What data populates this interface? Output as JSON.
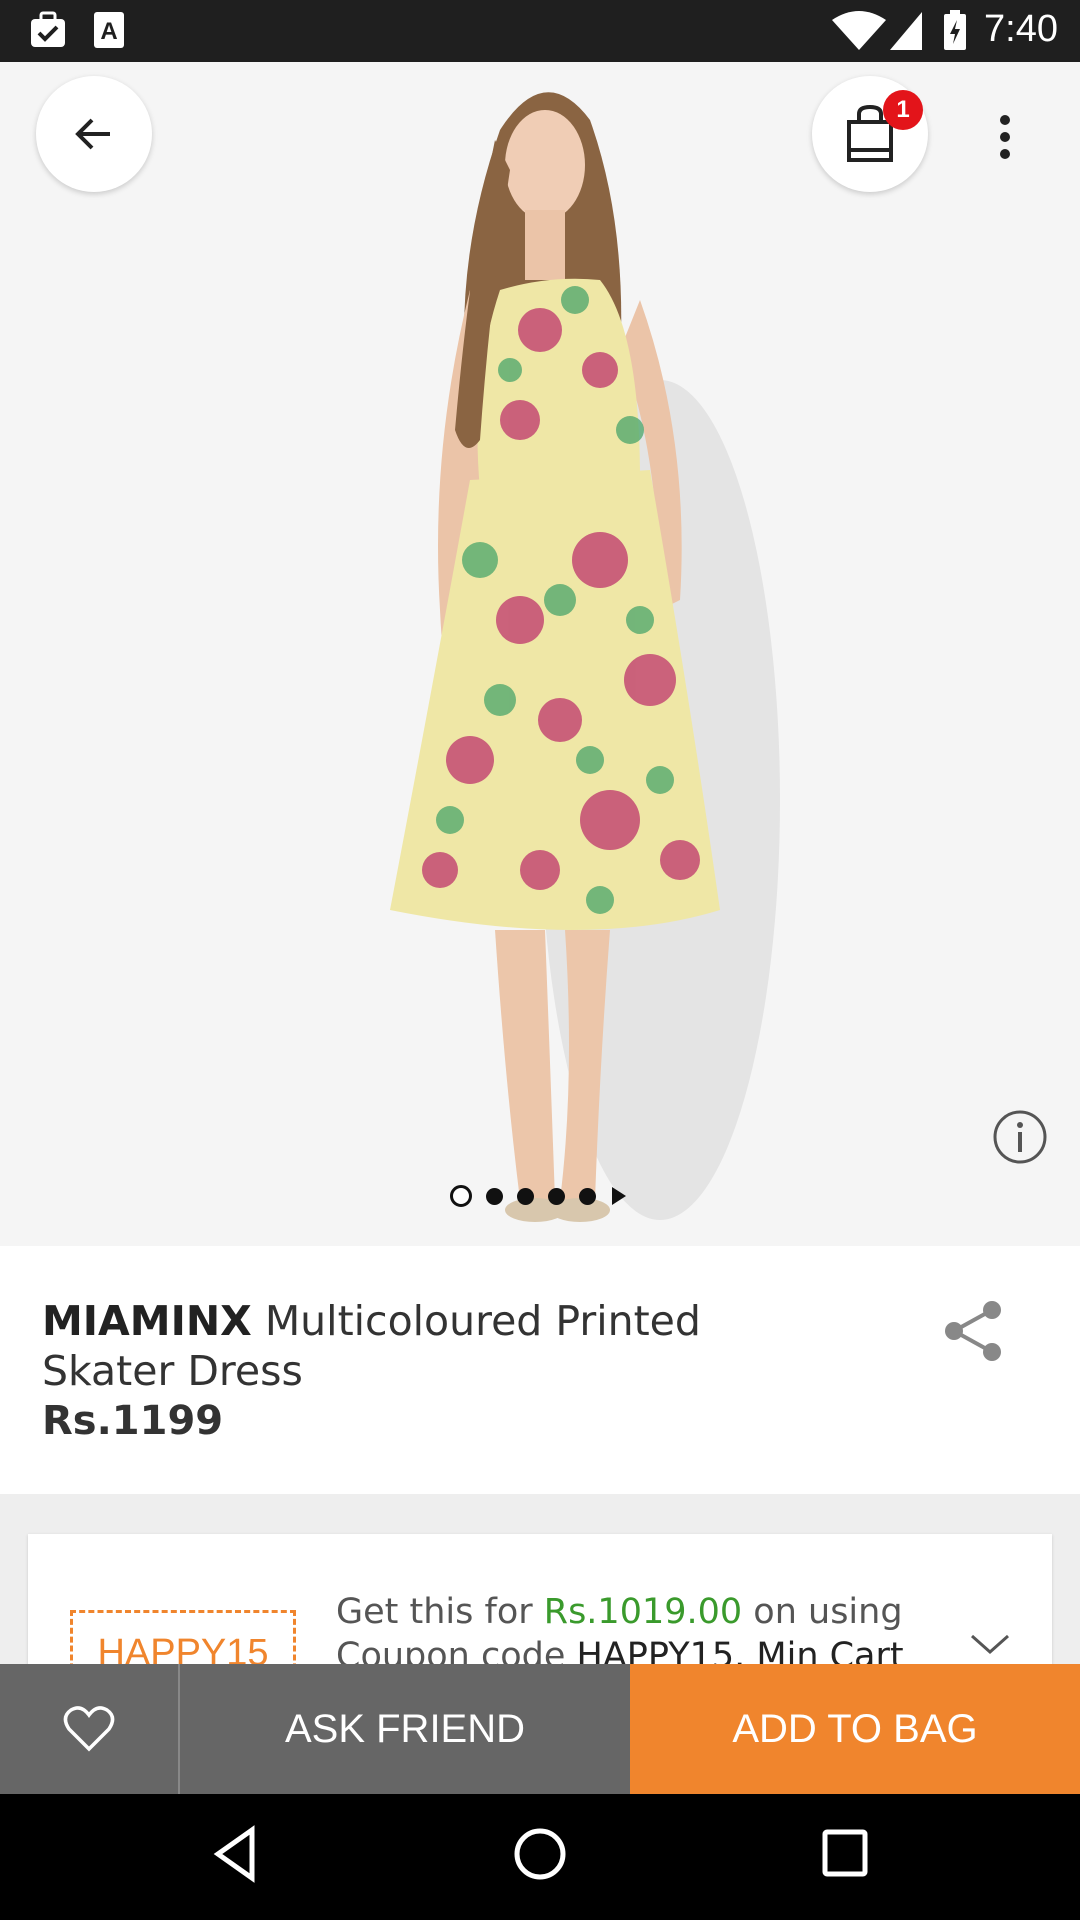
{
  "status_bar": {
    "time": "7:40",
    "icons": [
      "briefcase-check-icon",
      "a-font-icon",
      "wifi-icon",
      "signal-icon",
      "battery-charging-icon"
    ]
  },
  "product": {
    "brand": "MIAMINX",
    "name": "Multicoloured Printed Skater Dress",
    "price": "Rs.1199",
    "image_count": 5,
    "active_image_index": 0
  },
  "cart": {
    "count": "1"
  },
  "coupon": {
    "code": "HAPPY15",
    "text_prefix": "Get this for ",
    "discount_price": "Rs.1019.00",
    "text_middle": " on using",
    "line2_prefix": "Coupon code ",
    "line2_code": "HAPPY15",
    "line2_suffix": ". Min Cart Rs."
  },
  "actions": {
    "ask_friend": "ASK FRIEND",
    "add_to_bag": "ADD TO BAG"
  },
  "colors": {
    "accent": "#f0852d",
    "bar_gray": "#666666",
    "badge": "#e3141a",
    "green_price": "#3a9a2c"
  }
}
